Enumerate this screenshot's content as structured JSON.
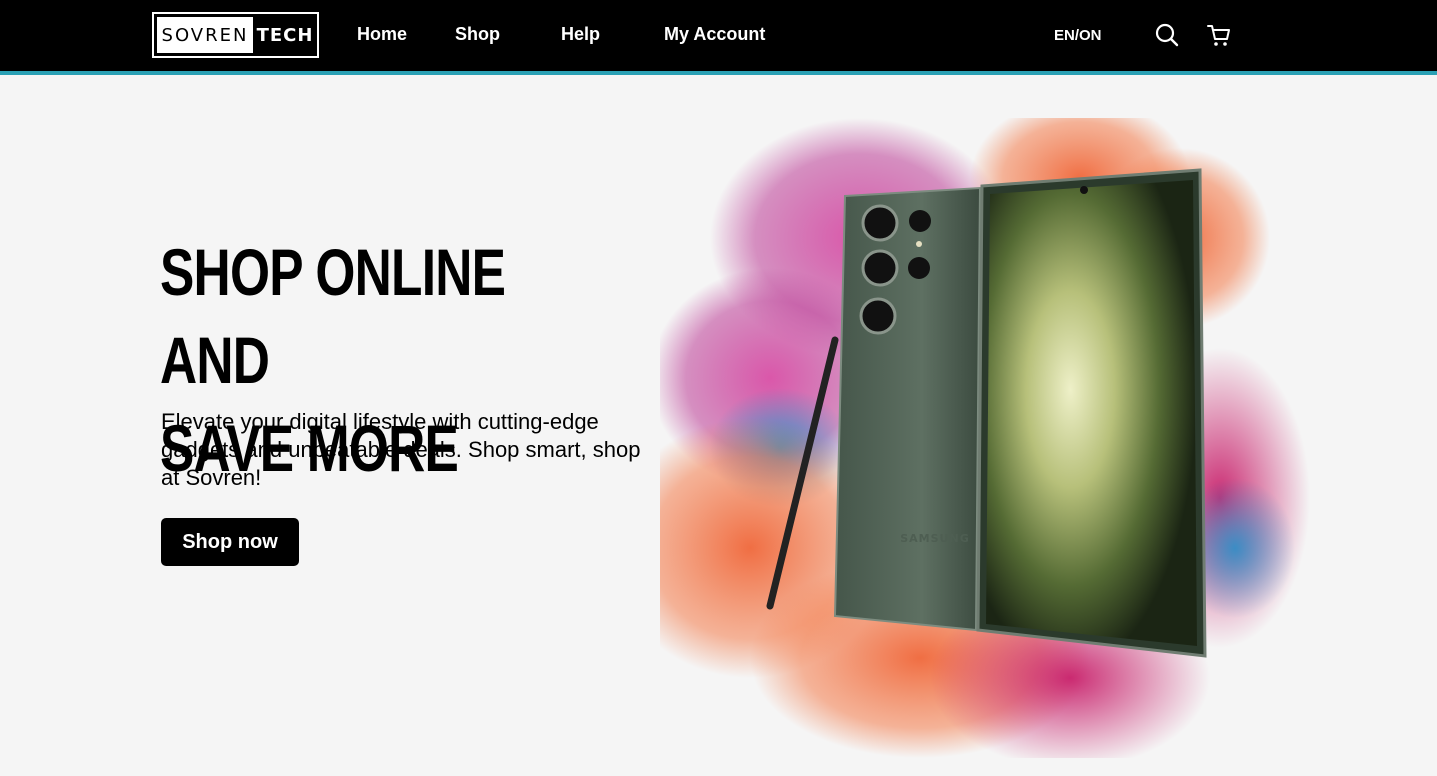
{
  "header": {
    "logo_left": "SOVREN",
    "logo_right": "TECH",
    "nav": {
      "home": "Home",
      "shop": "Shop",
      "help": "Help",
      "my_account": "My Account"
    },
    "language": "EN/ON",
    "icons": [
      "search-icon",
      "cart-icon"
    ],
    "accent_color": "#2aa0b4"
  },
  "hero": {
    "title_line1": "SHOP ONLINE AND",
    "title_line2": "SAVE MORE",
    "description": "Elevate your digital lifestyle with cutting-edge gadgets and unbeatable deals. Shop smart, shop at Sovren!",
    "cta_label": "Shop now",
    "phone_brand": "SAMSUNG"
  }
}
